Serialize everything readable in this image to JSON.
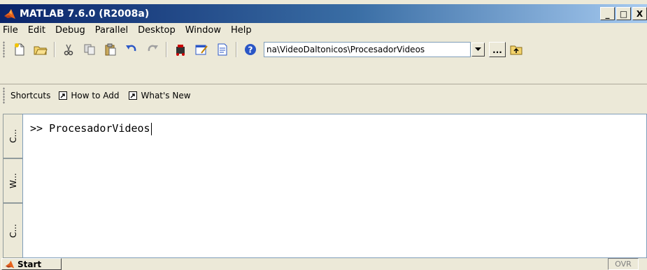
{
  "window": {
    "title": "MATLAB  7.6.0 (R2008a)",
    "controls": {
      "minimize": "_",
      "maximize": "□",
      "close": "X"
    }
  },
  "menu": [
    "File",
    "Edit",
    "Debug",
    "Parallel",
    "Desktop",
    "Window",
    "Help"
  ],
  "toolbar": {
    "icons": [
      "new-file-icon",
      "open-folder-icon",
      "cut-icon",
      "copy-icon",
      "paste-icon",
      "undo-icon",
      "redo-icon",
      "simulink-icon",
      "guide-icon",
      "profiler-icon",
      "help-icon"
    ],
    "current_folder": "na\\VideoDaltonicos\\ProcesadorVideos",
    "browse_label": "..."
  },
  "shortcuts": {
    "label": "Shortcuts",
    "items": [
      "How to Add",
      "What's New"
    ]
  },
  "side_tabs": [
    "C...",
    "W...",
    "C..."
  ],
  "command_window": {
    "prompt": ">>",
    "input": "ProcesadorVideos"
  },
  "statusbar": {
    "start_label": "Start",
    "ovr": "OVR"
  },
  "colors": {
    "titlebar_start": "#0a246a",
    "titlebar_end": "#a6caf0",
    "chrome": "#ece9d8",
    "matlab_orange": "#e8631a"
  }
}
